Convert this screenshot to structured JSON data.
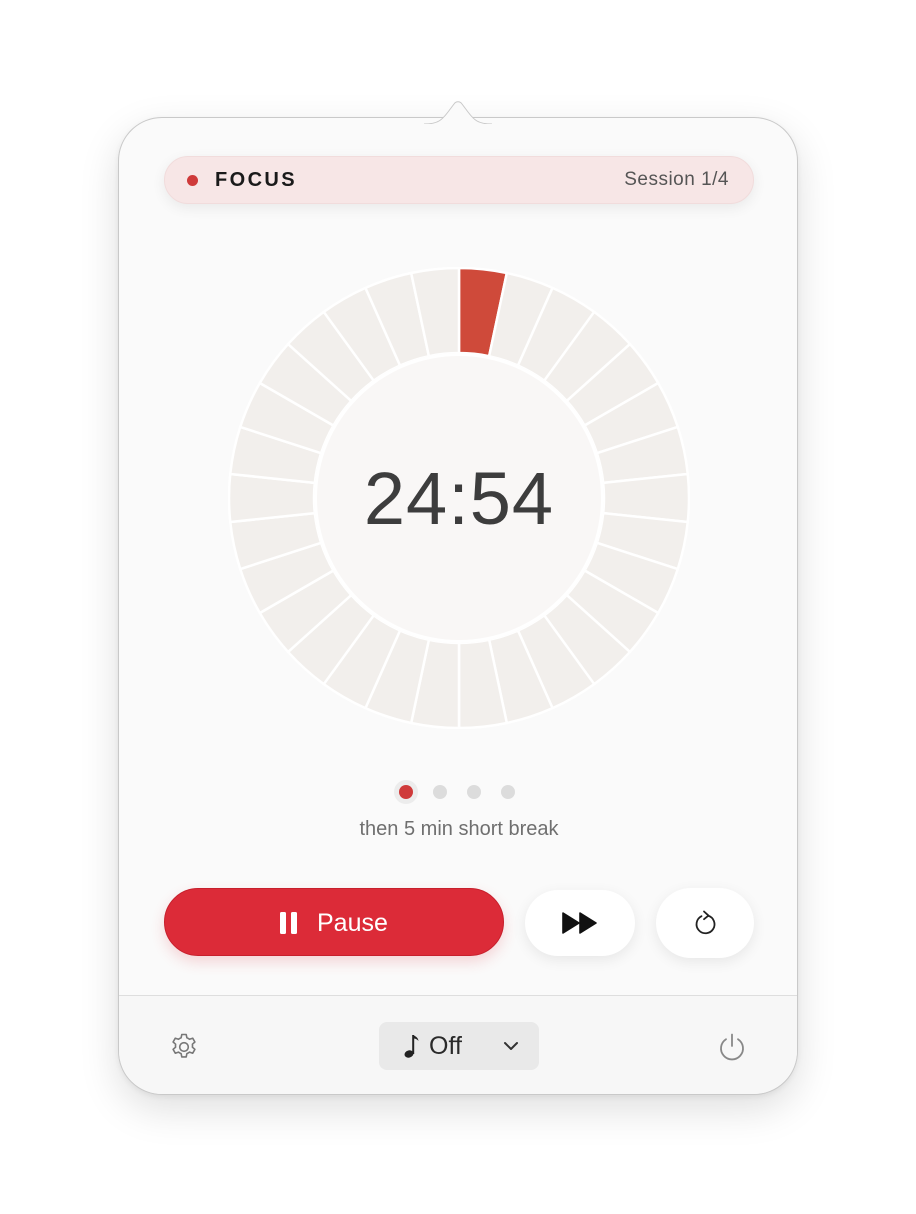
{
  "header": {
    "mode_label": "FOCUS",
    "session_label": "Session 1/4",
    "accent_color": "#cf3a3a",
    "pill_color": "#f7e6e6"
  },
  "timer": {
    "time_remaining": "24:54",
    "segment_count": 30,
    "elapsed_segments": 1,
    "elapsed_color": "#cf4a3a",
    "remaining_color": "#f2efec"
  },
  "sessions": {
    "total": 4,
    "current": 1,
    "next_label": "then 5 min short break"
  },
  "controls": {
    "pause_label": "Pause",
    "pause_icon": "pause-icon",
    "skip_icon": "fast-forward-icon",
    "reset_icon": "reset-icon",
    "button_color": "#dc2b38"
  },
  "footer": {
    "settings_icon": "gear-icon",
    "music_icon": "music-note-icon",
    "music_value": "Off",
    "music_chevron_icon": "chevron-down-icon",
    "power_icon": "power-icon"
  }
}
